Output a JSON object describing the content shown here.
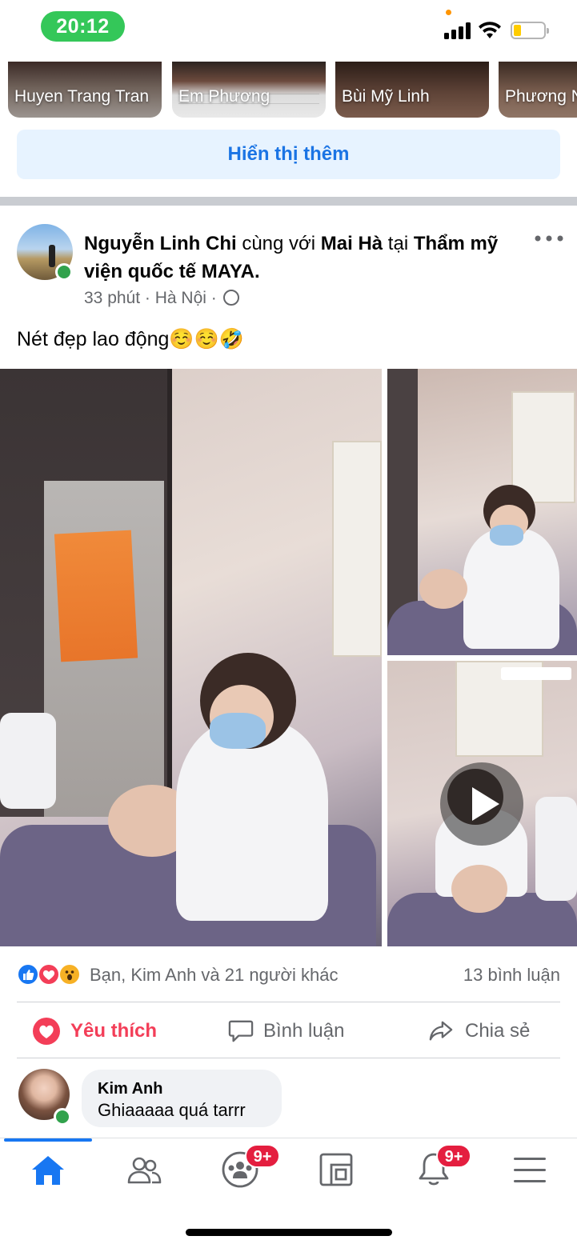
{
  "status_bar": {
    "time": "20:12"
  },
  "story_cards": [
    {
      "name": "Huyen Trang Tran"
    },
    {
      "name": "Em Phương"
    },
    {
      "name": "Bùi Mỹ Linh"
    },
    {
      "name": "Phương N"
    }
  ],
  "show_more_label": "Hiển thị thêm",
  "post": {
    "author": "Nguyễn Linh Chi",
    "with_word": " cùng với ",
    "tagged": "Mai Hà",
    "at_word": " tại ",
    "location": "Thẩm mỹ viện quốc tế MAYA.",
    "time": "33 phút",
    "place": "Hà Nội",
    "sep": " · ",
    "text": "Nét đẹp lao động☺️☺️🤣",
    "reactions_summary": "Bạn, Kim Anh và 21 người khác",
    "comment_count": "13 bình luận",
    "actions": {
      "like": "Yêu thích",
      "comment": "Bình luận",
      "share": "Chia sẻ"
    }
  },
  "comment": {
    "name": "Kim Anh",
    "text": "Ghiaaaaa quá tarrr"
  },
  "nav": {
    "groups_badge": "9+",
    "notifications_badge": "9+"
  },
  "colors": {
    "accent": "#1877f2",
    "love": "#f33e58",
    "status_green": "#34c759",
    "online_green": "#31a24c",
    "badge_red": "#e41e3f"
  }
}
